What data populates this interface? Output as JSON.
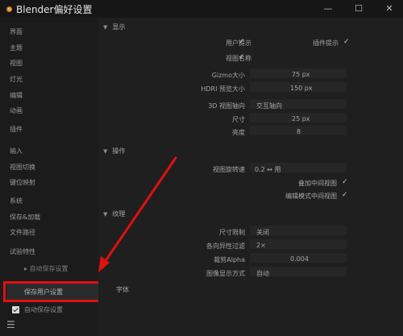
{
  "window": {
    "title": "Blender偏好设置",
    "minimize_glyph": "—",
    "maximize_glyph": "☐",
    "close_glyph": "✕"
  },
  "sidebar": {
    "items": [
      "界面",
      "主题",
      "视图",
      "灯光",
      "编辑",
      "动画",
      "插件",
      "输入",
      "视图切换",
      "键位映射",
      "系统",
      "保存&加载",
      "文件路径",
      "试验特性"
    ],
    "save_auto": "▸ 自动保存设置",
    "save_button": "保存用户设置",
    "auto_save_label": "自动保存设置"
  },
  "sections": {
    "display": "显示",
    "manipulate": "操作",
    "texture": "纹理",
    "footer": "字体"
  },
  "display": {
    "tooltips_label": "用户提示",
    "python_tooltips_label": "插件提示",
    "view_name_label": "视图名称",
    "gizmo_label": "Gizmo大小",
    "gizmo_value": "75 px",
    "hdri_label": "HDRI 预览大小",
    "hdri_value": "150 px",
    "viewport_3d_label": "3D 视图轴向",
    "viewport_3d_value": "交互轴向",
    "size_label": "尺寸",
    "size_value": "25 px",
    "brightness_label": "亮度",
    "brightness_value": "8"
  },
  "manipulate": {
    "transform_label": "视图旋转速",
    "transform_value": "0.2 ↔ 用",
    "overlay_label": "叠加中间视图",
    "edit_mode_label": "编辑模式中间视图"
  },
  "texture": {
    "limit_label": "尺寸限制",
    "limit_value": "关闭",
    "anisotropic_label": "各向异性过滤",
    "anisotropic_value": "2×",
    "clip_alpha_label": "裁剪Alpha",
    "clip_alpha_value": "0.004",
    "image_display_label": "图像显示方式",
    "image_display_value": "自动"
  },
  "colors": {
    "highlight": "#e01010",
    "background": "#1d1d1d"
  }
}
